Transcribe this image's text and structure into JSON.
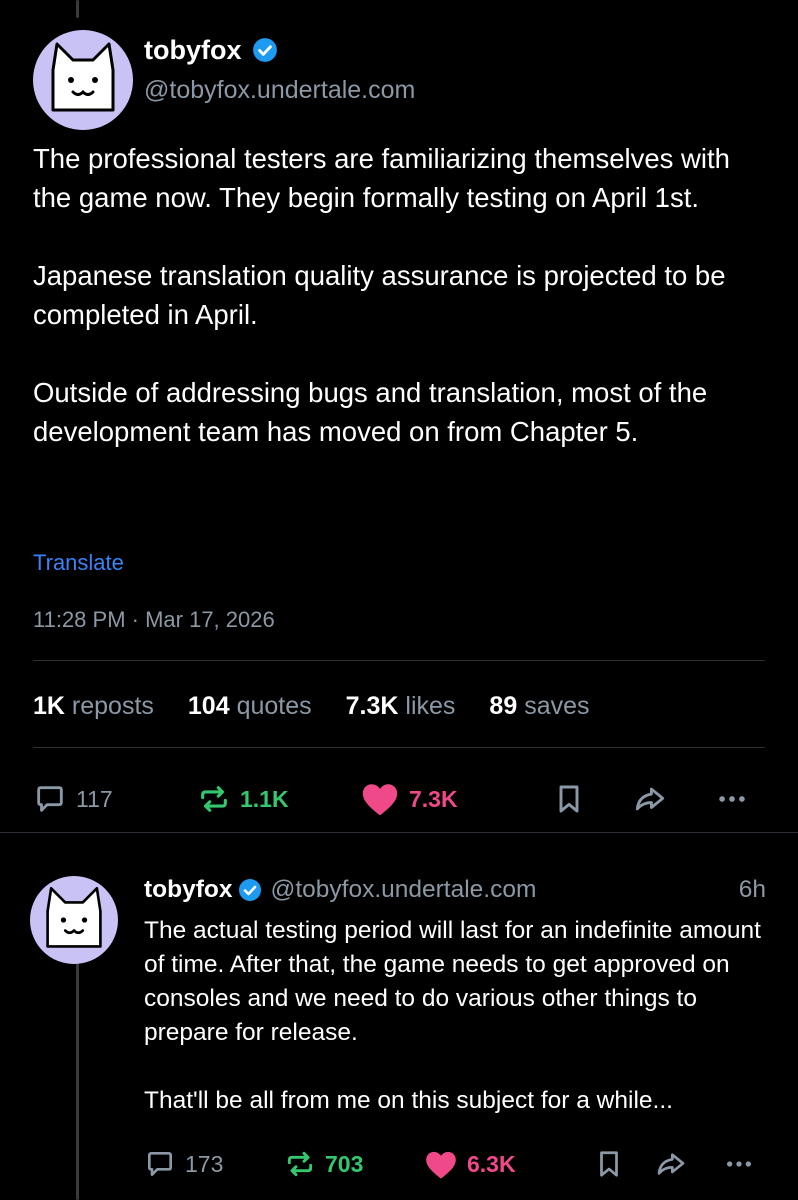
{
  "post": {
    "display_name": "tobyfox",
    "handle": "@tobyfox.undertale.com",
    "body": "The professional testers are familiarizing themselves with the game now. They begin formally testing on April 1st.\n\nJapanese translation quality assurance is projected to be completed in April.\n\nOutside of addressing bugs and translation, most of the development team has moved on from Chapter 5.",
    "translate_label": "Translate",
    "timestamp": "11:28 PM · Mar 17, 2026",
    "stats": [
      {
        "num": "1K",
        "label": "reposts"
      },
      {
        "num": "104",
        "label": "quotes"
      },
      {
        "num": "7.3K",
        "label": "likes"
      },
      {
        "num": "89",
        "label": "saves"
      }
    ],
    "actions": {
      "replies": "117",
      "reposts": "1.1K",
      "likes": "7.3K"
    }
  },
  "reply": {
    "display_name": "tobyfox",
    "handle": "@tobyfox.undertale.com",
    "time": "6h",
    "body": "The actual testing period will last for an indefinite amount of time. After that, the game needs to get approved on consoles and we need to do various other things to prepare for release.\n\nThat'll be all from me on this subject for a while...",
    "actions": {
      "replies": "173",
      "reposts": "703",
      "likes": "6.3K"
    }
  },
  "colors": {
    "background": "#000000",
    "text": "#ffffff",
    "secondary_text": "#8b98a5",
    "link": "#3b82f6",
    "verified": "#1d9bf0",
    "repost_green": "#35c76e",
    "like_pink": "#f0498a",
    "avatar_bg": "#c9c2f5"
  },
  "icons": [
    "verified-badge-icon",
    "reply-icon",
    "repost-icon",
    "heart-icon",
    "bookmark-icon",
    "share-icon",
    "more-icon"
  ]
}
